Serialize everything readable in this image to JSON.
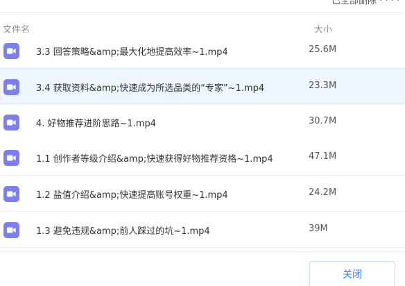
{
  "header": {
    "clipped_text": "已全部删除 · · · ·",
    "col_name": "文件名",
    "col_size": "大小"
  },
  "colors": {
    "icon": "#7b7ff0",
    "selected_row": "#eef5fe",
    "button_text": "#2f7ff0"
  },
  "files": [
    {
      "name": "3.3 回答策略&amp;最大化地提高效率~1.mp4",
      "size": "25.6M",
      "icon": "video-file-icon"
    },
    {
      "name": "3.4 获取资料&amp;快速成为所选品类的“专家”~1.mp4",
      "size": "23.3M",
      "icon": "video-file-icon"
    },
    {
      "name": "4. 好物推荐进阶思路~1.mp4",
      "size": "30.7M",
      "icon": "video-file-icon"
    },
    {
      "name": "1.1 创作者等级介绍&amp;快速获得好物推荐资格~1.mp4",
      "size": "47.1M",
      "icon": "video-file-icon"
    },
    {
      "name": "1.2 盐值介绍&amp;快速提高账号权重~1.mp4",
      "size": "24.2M",
      "icon": "video-file-icon"
    },
    {
      "name": "1.3 避免违规&amp;前人踩过的坑~1.mp4",
      "size": "39M",
      "icon": "video-file-icon"
    }
  ],
  "footer": {
    "close_label": "关闭"
  }
}
